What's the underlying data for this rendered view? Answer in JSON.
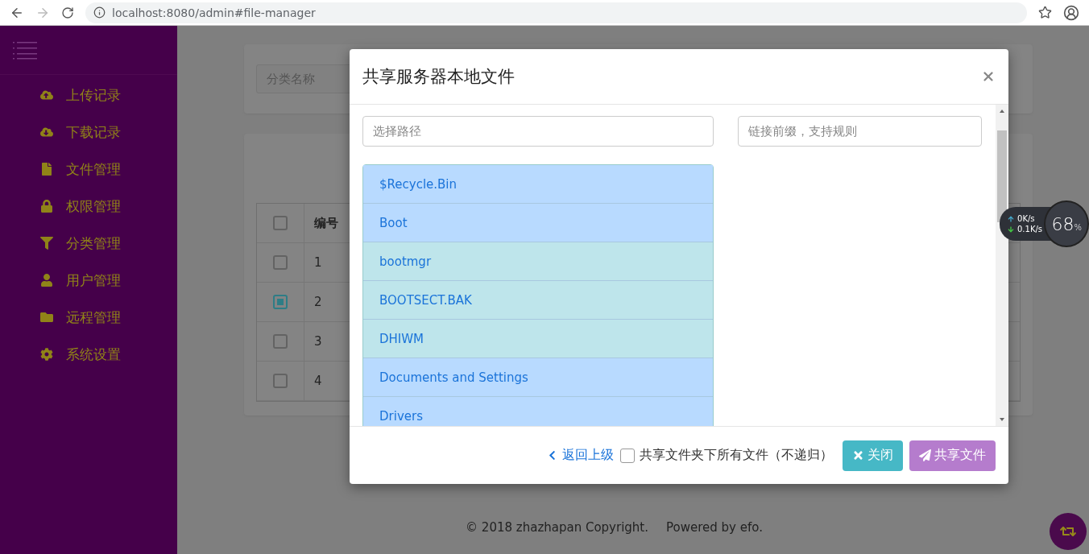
{
  "browser": {
    "url": "localhost:8080/admin#file-manager"
  },
  "sidebar": {
    "items": [
      {
        "label": "上传记录"
      },
      {
        "label": "下载记录"
      },
      {
        "label": "文件管理"
      },
      {
        "label": "权限管理"
      },
      {
        "label": "分类管理"
      },
      {
        "label": "用户管理"
      },
      {
        "label": "远程管理"
      },
      {
        "label": "系统设置"
      }
    ]
  },
  "page": {
    "search_placeholder": "分类名称",
    "table": {
      "header_checked": false,
      "column": "编号",
      "rows": [
        {
          "number": "1",
          "checked": false
        },
        {
          "number": "2",
          "checked": true
        },
        {
          "number": "3",
          "checked": false
        },
        {
          "number": "4",
          "checked": false
        }
      ]
    }
  },
  "modal": {
    "title": "共享服务器本地文件",
    "path_placeholder": "选择路径",
    "prefix_placeholder": "链接前缀，支持规则",
    "files": [
      {
        "name": "$Recycle.Bin",
        "kind": "folder"
      },
      {
        "name": "Boot",
        "kind": "folder"
      },
      {
        "name": "bootmgr",
        "kind": "file"
      },
      {
        "name": "BOOTSECT.BAK",
        "kind": "file"
      },
      {
        "name": "DHIWM",
        "kind": "file"
      },
      {
        "name": "Documents and Settings",
        "kind": "folder"
      },
      {
        "name": "Drivers",
        "kind": "folder"
      }
    ],
    "back_link": "返回上级",
    "recursive": {
      "label": "共享文件夹下所有文件（不递归）",
      "checked": false
    },
    "close_button": "关闭",
    "share_button": "共享文件"
  },
  "speed_widget": {
    "up": {
      "value": "0",
      "unit": "K/s"
    },
    "down": {
      "value": "0.1",
      "unit": "K/s"
    },
    "percent": {
      "value": "68",
      "unit": "%"
    }
  },
  "footer": {
    "copyright": "© 2018 zhazhapan Copyright.",
    "powered": "Powered by efo."
  }
}
